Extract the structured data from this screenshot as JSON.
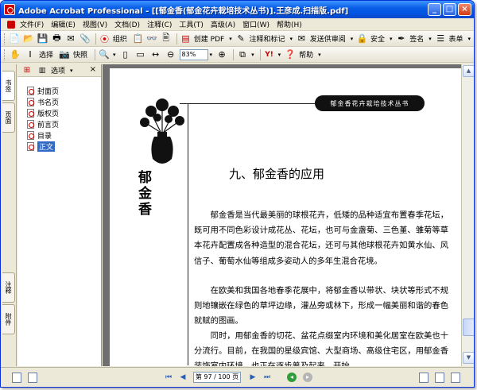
{
  "window": {
    "title": "Adobe Acrobat Professional - [[郁金香(郁金花卉栽培技术丛书)].王彦成.扫描版.pdf]",
    "buttons": {
      "minimize": "_",
      "maximize": "□",
      "close": "×"
    }
  },
  "menu": [
    {
      "label": "文件(F)"
    },
    {
      "label": "编辑(E)"
    },
    {
      "label": "视图(V)"
    },
    {
      "label": "文档(D)"
    },
    {
      "label": "注释(C)"
    },
    {
      "label": "工具(T)"
    },
    {
      "label": "高级(A)"
    },
    {
      "label": "窗口(W)"
    },
    {
      "label": "帮助(H)"
    }
  ],
  "toolbar1": {
    "organize": "组织",
    "create_pdf": "创建 PDF",
    "comment_markup": "注释和标记",
    "send_review": "发送供审阅",
    "secure": "安全",
    "sign": "签名",
    "forms": "表单"
  },
  "toolbar2": {
    "select": "选择",
    "snapshot": "快照",
    "zoom": "83%",
    "help": "帮助"
  },
  "side_tabs": [
    "书签",
    "页面",
    "注释",
    "附件"
  ],
  "bookmarks": {
    "options": "选项",
    "items": [
      "封面页",
      "书名页",
      "版权页",
      "前言页",
      "目录",
      "正文"
    ],
    "selected_index": 5
  },
  "document": {
    "banner": "郁金香花卉栽培技术丛书",
    "side_title": "郁金香",
    "heading": "九、郁金香的应用",
    "paragraphs": [
      "　　郁金香是当代最美丽的球根花卉，低矮的品种适宜布置春季花坛，既可用不同色彩设计成花丛、花坛，也可与金盏菊、三色堇、雏菊等草本花卉配置成各种造型的混合花坛，还可与其他球根花卉如黄水仙、风信子、葡萄水仙等组成多姿动人的多年生混合花境。",
      "　　在欧美和我国各地春季花展中，将郁金香以带状、块状等形式不规则地镶嵌在绿色的草坪边缘，灌丛旁或林下，形成一幅美丽和谐的春色就赋的图画。",
      "　　同时，用郁金香的切花、盆花点缀室内环境和美化居室在欧美也十分流行。目前，在我国的星级宾馆、大型商场、高级住宅区，用郁金香装饰室内环境，也正在逐步普及起来，开始"
    ]
  },
  "status": {
    "page_display": "第 97 / 100 页",
    "current_page": 97,
    "total_pages": 100
  },
  "colors": {
    "titlebar": "#0054e3",
    "selection": "#316ac5",
    "doc_background": "#6f6f6f"
  }
}
